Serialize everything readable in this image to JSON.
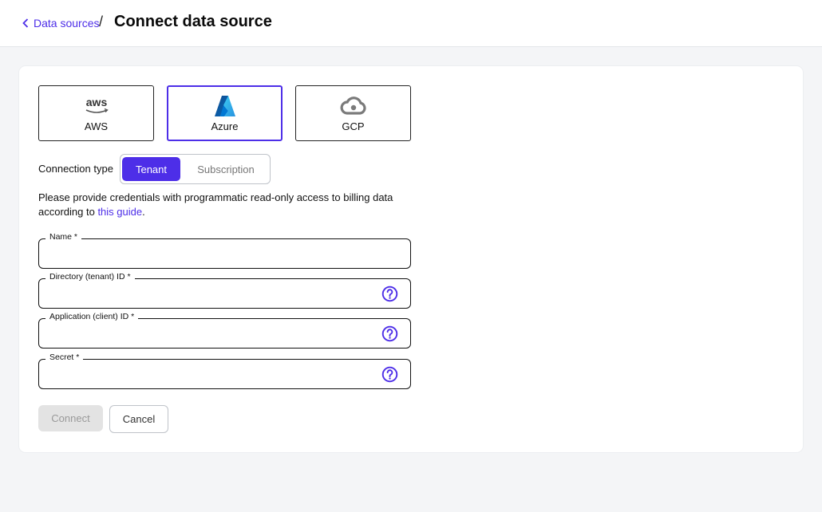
{
  "header": {
    "back_label": "Data sources",
    "separator": "/",
    "title": "Connect data source"
  },
  "providers": [
    {
      "label": "AWS",
      "icon": "aws-logo-icon",
      "selected": false
    },
    {
      "label": "Azure",
      "icon": "azure-logo-icon",
      "selected": true
    },
    {
      "label": "GCP",
      "icon": "gcp-cloud-icon",
      "selected": false
    }
  ],
  "connection": {
    "label": "Connection type",
    "options": [
      "Tenant",
      "Subscription"
    ],
    "selected": "Tenant"
  },
  "info": {
    "text": "Please provide credentials with programmatic read-only access to billing data according to ",
    "link": "this guide",
    "suffix": "."
  },
  "fields": [
    {
      "label": "Name *",
      "value": "",
      "help": false
    },
    {
      "label": "Directory (tenant) ID *",
      "value": "",
      "help": true
    },
    {
      "label": "Application (client) ID *",
      "value": "",
      "help": true
    },
    {
      "label": "Secret *",
      "value": "",
      "help": true
    }
  ],
  "actions": {
    "connect": "Connect",
    "cancel": "Cancel"
  },
  "colors": {
    "accent": "#4d2ee8",
    "disabled_bg": "#e3e3e3",
    "page_bg": "#f4f5f7"
  },
  "aws_logo_text": "aws"
}
